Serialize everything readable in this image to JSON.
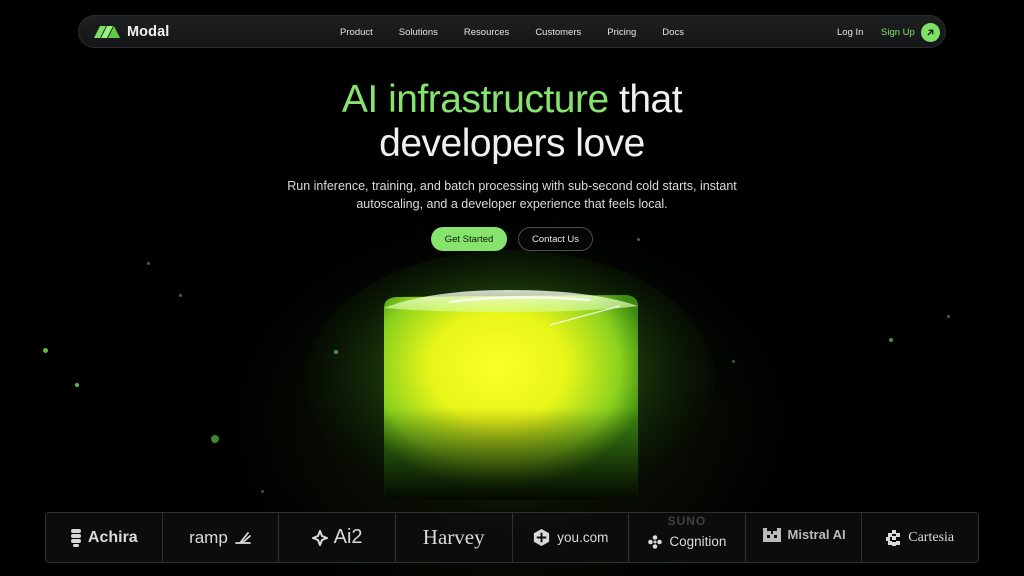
{
  "brand": {
    "name": "Modal",
    "accent_color": "#86e36e",
    "background_color": "#000000"
  },
  "nav": {
    "links": [
      "Product",
      "Solutions",
      "Resources",
      "Customers",
      "Pricing",
      "Docs"
    ],
    "login_label": "Log In",
    "signup_label": "Sign Up",
    "signup_icon": "arrow-up-right-icon"
  },
  "hero": {
    "title_accent": "AI infrastructure",
    "title_rest_1": "that",
    "title_line_2": "developers love",
    "subtitle": "Run inference, training, and batch processing with sub-second cold starts, instant autoscaling, and a developer experience that feels local.",
    "primary_cta": "Get Started",
    "secondary_cta": "Contact Us"
  },
  "customers": [
    {
      "name": "Achira",
      "icon": "achira-logo-icon"
    },
    {
      "name": "ramp",
      "icon": "ramp-logo-icon"
    },
    {
      "name": "Ai2",
      "icon": "ai2-logo-icon"
    },
    {
      "name": "Harvey",
      "icon": ""
    },
    {
      "name": "you.com",
      "icon": "you-com-logo-icon"
    },
    {
      "name": "Cognition",
      "icon": "cognition-logo-icon",
      "faded_above": "SUNO"
    },
    {
      "name": "Mistral AI",
      "icon": "mistral-logo-icon"
    },
    {
      "name": "Cartesia",
      "icon": "cartesia-logo-icon"
    }
  ]
}
